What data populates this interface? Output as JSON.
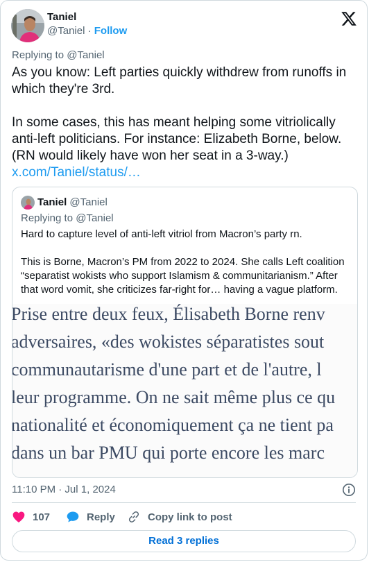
{
  "author": {
    "name": "Taniel",
    "handle": "@Taniel",
    "separator": "·",
    "follow_label": "Follow"
  },
  "icons": {
    "logo": "x-logo-icon",
    "info": "info-icon",
    "like": "heart-icon",
    "reply": "speech-bubble-icon",
    "copy_link": "link-icon"
  },
  "colors": {
    "accent": "#1d9bf0",
    "like": "#f91880",
    "muted": "#536471",
    "border": "#cfd9de"
  },
  "tweet": {
    "replying_to": "Replying to @Taniel",
    "para1": "As you know: Left parties quickly withdrew from runoffs in which they're 3rd.",
    "para2": "In some cases, this has meant helping some vitriolically anti-left politicians. For instance: Elizabeth Borne, below. (RN would likely have won her seat in a 3-way.)",
    "link": "x.com/Taniel/status/…",
    "timestamp": "11:10 PM · Jul 1, 2024"
  },
  "quote": {
    "name": "Taniel",
    "handle": "@Taniel",
    "replying_to": "Replying to @Taniel",
    "para1": "Hard to capture level of anti-left vitriol from Macron’s party rn.",
    "para2": "This is Borne, Macron’s PM from 2022 to 2024. She calls Left coalition “separatist wokists who support Islamism & communitarianism.” After that word vomit, she criticizes far-right for… having a vague platform.",
    "image_lines": [
      "Prise entre deux feux, Élisabeth Borne renv",
      "adversaires, «des wokistes séparatistes sout",
      "communautarisme d'une part et de l'autre, l",
      "leur programme. On ne sait même plus ce qu",
      "nationalité et économiquement ça ne tient pa",
      "dans un bar PMU qui porte encore les marc"
    ]
  },
  "actions": {
    "like_count": "107",
    "reply_label": "Reply",
    "copy_label": "Copy link to post",
    "read_replies_label": "Read 3 replies"
  }
}
